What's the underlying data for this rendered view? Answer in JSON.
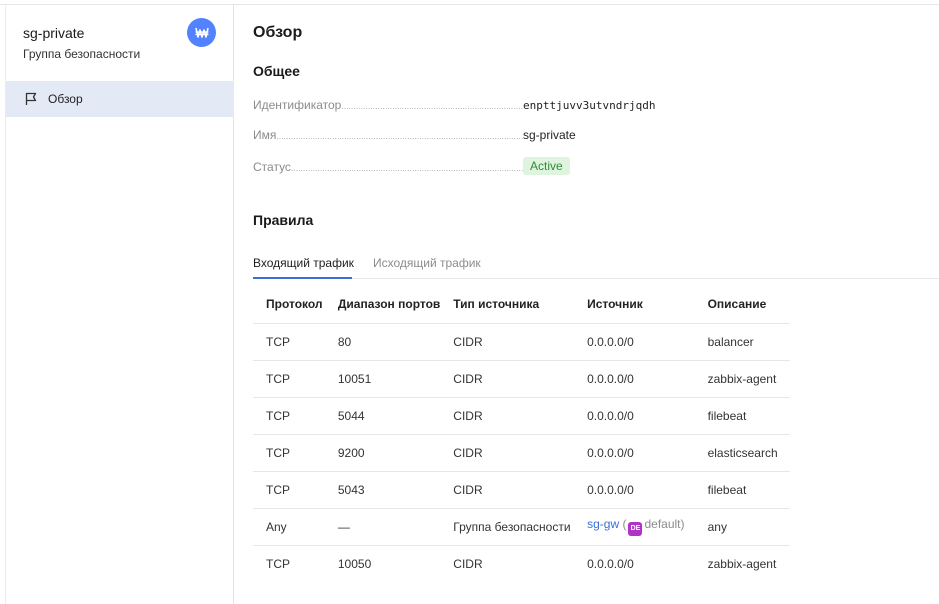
{
  "sidebar": {
    "title": "sg-private",
    "subtitle": "Группа безопасности",
    "badge_icon": "security-group-icon",
    "accent": "#5282ff",
    "items": [
      {
        "label": "Обзор",
        "icon": "flag-icon",
        "selected": true
      }
    ]
  },
  "main": {
    "page_title": "Обзор",
    "general_title": "Общее",
    "fields": {
      "id_label": "Идентификатор",
      "id_value": "enpttjuvv3utvndrjqdh",
      "name_label": "Имя",
      "name_value": "sg-private",
      "status_label": "Статус",
      "status_value": "Active"
    },
    "rules_title": "Правила",
    "tabs": [
      {
        "label": "Входящий трафик",
        "active": true
      },
      {
        "label": "Исходящий трафик",
        "active": false
      }
    ],
    "table": {
      "headers": [
        "Протокол",
        "Диапазон портов",
        "Тип источника",
        "Источник",
        "Описание"
      ],
      "rows": [
        [
          "TCP",
          "80",
          "CIDR",
          "0.0.0.0/0",
          "balancer"
        ],
        [
          "TCP",
          "10051",
          "CIDR",
          "0.0.0.0/0",
          "zabbix-agent"
        ],
        [
          "TCP",
          "5044",
          "CIDR",
          "0.0.0.0/0",
          "filebeat"
        ],
        [
          "TCP",
          "9200",
          "CIDR",
          "0.0.0.0/0",
          "elasticsearch"
        ],
        [
          "TCP",
          "5043",
          "CIDR",
          "0.0.0.0/0",
          "filebeat"
        ],
        [
          "Any",
          "—",
          "Группа безопасности",
          "",
          "any"
        ],
        [
          "TCP",
          "10050",
          "CIDR",
          "0.0.0.0/0",
          "zabbix-agent"
        ]
      ],
      "sg_source": {
        "link": "sg-gw",
        "open_paren": "(",
        "folder_badge": "DE",
        "folder": "default",
        "close_paren": ")"
      }
    }
  }
}
